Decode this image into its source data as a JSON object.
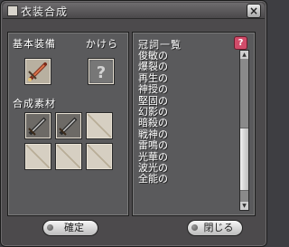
{
  "window": {
    "title": "衣装合成",
    "close_glyph": "×"
  },
  "left_panel": {
    "base_label": "基本装備",
    "fragment_label": "かけら",
    "materials_label": "合成素材",
    "base_slot_icon": "sword-item-icon",
    "fragment_slot_icon": "question-mark-icon",
    "material_slots": [
      {
        "state": "filled",
        "icon": "dagger-item-icon"
      },
      {
        "state": "filled",
        "icon": "dagger-item-icon"
      },
      {
        "state": "empty",
        "icon": ""
      },
      {
        "state": "empty",
        "icon": ""
      },
      {
        "state": "empty",
        "icon": ""
      },
      {
        "state": "empty",
        "icon": ""
      }
    ]
  },
  "right_panel": {
    "title": "冠詞一覧",
    "help_glyph": "?",
    "items": [
      "俊敏の",
      "爆裂の",
      "再生の",
      "神授の",
      "堅固の",
      "幻影の",
      "暗殺の",
      "戦神の",
      "雷鳴の",
      "光華の",
      "波光の",
      "全能の"
    ]
  },
  "buttons": {
    "confirm_label": "確定",
    "close_label": "閉じる"
  },
  "colors": {
    "frame": "#4c4a4c",
    "panel": "#5a5a5c",
    "help": "#d24c6a",
    "slot_empty": "#d6cfc2"
  }
}
